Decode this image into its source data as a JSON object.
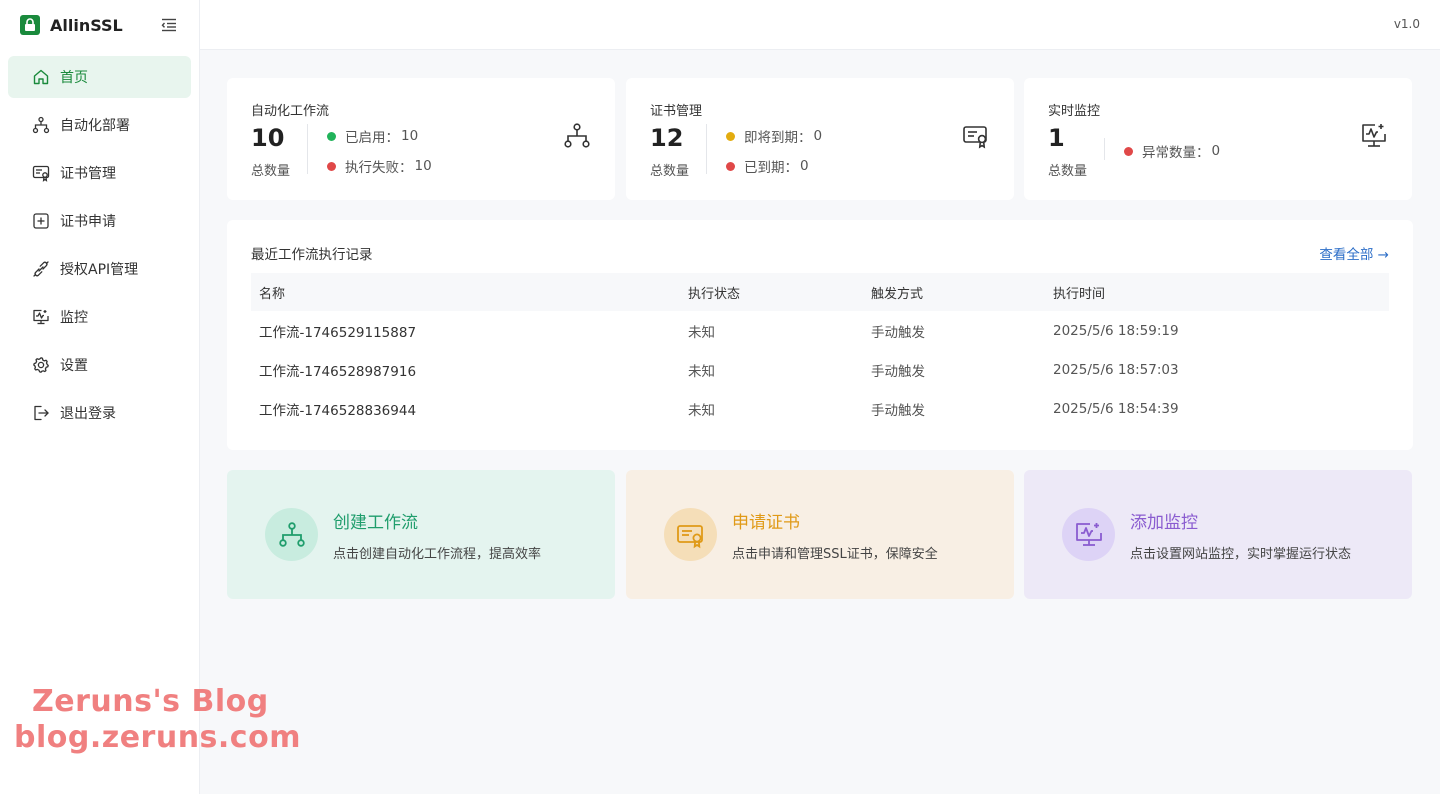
{
  "brand": {
    "name": "AllinSSL",
    "version": "v1.0"
  },
  "sidebar": {
    "items": [
      {
        "label": "首页",
        "icon": "home-icon",
        "active": true
      },
      {
        "label": "自动化部署",
        "icon": "workflow-icon"
      },
      {
        "label": "证书管理",
        "icon": "certificate-icon"
      },
      {
        "label": "证书申请",
        "icon": "plus-square-icon"
      },
      {
        "label": "授权API管理",
        "icon": "api-plug-icon"
      },
      {
        "label": "监控",
        "icon": "monitor-icon"
      },
      {
        "label": "设置",
        "icon": "gear-icon"
      },
      {
        "label": "退出登录",
        "icon": "logout-icon"
      }
    ]
  },
  "stats": [
    {
      "title": "自动化工作流",
      "count": "10",
      "count_label": "总数量",
      "icon": "workflow-icon",
      "rows": [
        {
          "label": "已启用：",
          "value": "10",
          "color": "#21b35a"
        },
        {
          "label": "执行失败：",
          "value": "10",
          "color": "#e04848"
        }
      ]
    },
    {
      "title": "证书管理",
      "count": "12",
      "count_label": "总数量",
      "icon": "certificate-icon",
      "rows": [
        {
          "label": "即将到期：",
          "value": "0",
          "color": "#e3ac0f"
        },
        {
          "label": "已到期：",
          "value": "0",
          "color": "#e04848"
        }
      ]
    },
    {
      "title": "实时监控",
      "count": "1",
      "count_label": "总数量",
      "icon": "monitor-icon",
      "rows": [
        {
          "label": "异常数量：",
          "value": "0",
          "color": "#e04848"
        }
      ]
    }
  ],
  "recent": {
    "title": "最近工作流执行记录",
    "view_all": "查看全部 →",
    "headers": [
      "名称",
      "执行状态",
      "触发方式",
      "执行时间"
    ],
    "rows": [
      [
        "工作流-1746529115887",
        "未知",
        "手动触发",
        "2025/5/6 18:59:19"
      ],
      [
        "工作流-1746528987916",
        "未知",
        "手动触发",
        "2025/5/6 18:57:03"
      ],
      [
        "工作流-1746528836944",
        "未知",
        "手动触发",
        "2025/5/6 18:54:39"
      ]
    ]
  },
  "actions": [
    {
      "title": "创建工作流",
      "desc": "点击创建自动化工作流程，提高效率",
      "icon": "workflow-icon",
      "color": "#1f9d6c"
    },
    {
      "title": "申请证书",
      "desc": "点击申请和管理SSL证书，保障安全",
      "icon": "certificate-icon",
      "color": "#e09a17"
    },
    {
      "title": "添加监控",
      "desc": "点击设置网站监控，实时掌握运行状态",
      "icon": "monitor-icon",
      "color": "#8a5cd0"
    }
  ],
  "watermark": {
    "line1": "Zeruns's Blog",
    "line2": "blog.zeruns.com"
  }
}
